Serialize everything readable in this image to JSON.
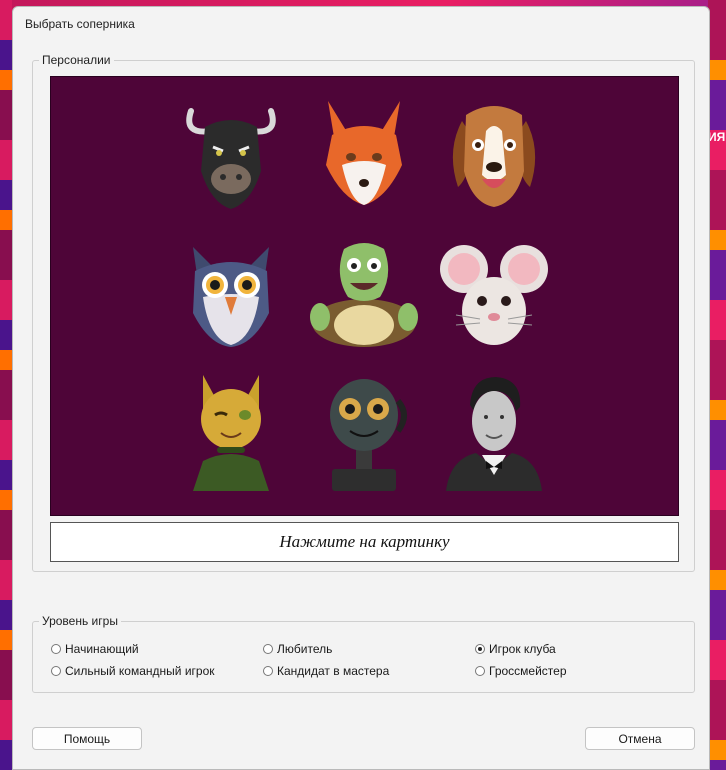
{
  "window": {
    "title": "Выбрать соперника"
  },
  "personalities": {
    "legend": "Персоналии",
    "avatars": [
      {
        "name": "bull-icon"
      },
      {
        "name": "fox-icon"
      },
      {
        "name": "beagle-icon"
      },
      {
        "name": "owl-icon"
      },
      {
        "name": "turtle-icon"
      },
      {
        "name": "mouse-icon"
      },
      {
        "name": "cat-icon"
      },
      {
        "name": "robot-icon"
      },
      {
        "name": "gentleman-icon"
      }
    ],
    "hint": "Нажмите на картинку",
    "background_color": "#4e0538"
  },
  "level": {
    "legend": "Уровень игры",
    "options": [
      {
        "label": "Начинающий",
        "checked": false
      },
      {
        "label": "Любитель",
        "checked": false
      },
      {
        "label": "Игрок клуба",
        "checked": true
      },
      {
        "label": "Сильный командный игрок",
        "checked": false
      },
      {
        "label": "Кандидат в мастера",
        "checked": false
      },
      {
        "label": "Гроссмейстер",
        "checked": false
      }
    ]
  },
  "buttons": {
    "help": "Помощь",
    "cancel": "Отмена"
  },
  "background": {
    "right_text": "ИЯ"
  }
}
